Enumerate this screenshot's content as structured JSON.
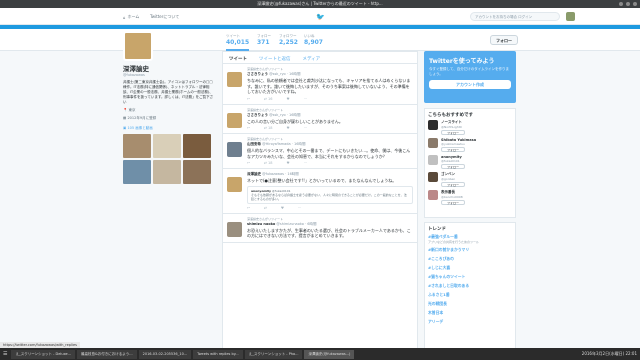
{
  "window": {
    "title": "深澤諭史(@fukazawas)さん | Twitterからの最近のツイート - http..."
  },
  "topnav": {
    "home": "ホーム",
    "about": "Twitterについて",
    "search_placeholder": "アカウントをお持ちの場合 ログイン",
    "tweet_button": "ツイート"
  },
  "profile_nav": {
    "stats": [
      {
        "label": "ツイート",
        "value": "40,015"
      },
      {
        "label": "フォロー",
        "value": "371"
      },
      {
        "label": "フォロワー",
        "value": "2,252"
      },
      {
        "label": "いいね",
        "value": "8,907"
      }
    ],
    "follow_button": "フォロー"
  },
  "profile": {
    "name": "深澤諭史",
    "handle": "@fukazawas",
    "bio": "弁護士(第二東京弁護士会)。アイコンはフォロワーの□□様作。IT法務(特に通信関係)、ネットトラブル・法律相談、IT企業の一般法務、弁護士業務(ホームの一般法務)、刑事事件を扱っています。詳しくは、IT法務」をご覧下さい",
    "location": "東京",
    "joined": "2012年9月に登録",
    "media_label": "105 画像と動画"
  },
  "timeline": {
    "tabs": [
      "ツイート",
      "ツイートと返信",
      "メディア"
    ],
    "tweets": [
      {
        "rt": "深澤諭史さんがリツイート",
        "name": "ささきりょう",
        "handle": "@ssk_ryo · 16時間",
        "body": "ちなみに、私の依頼者では会社と裁判沙汰になっても、キャリアを捨てる人はめくらないます。誰いです。誰いて後悔したいますが、そのうち事案は後悔していないよう、その準備をしておいた方がいいですね。",
        "replies": "",
        "rts": "16",
        "likes": ""
      },
      {
        "rt": "深澤諭史さんがリツイート",
        "name": "ささきりょう",
        "handle": "@ssk_ryo · 16時間",
        "body": "この人の言い分ご自身が疑わしいことがありません。",
        "replies": "",
        "rts": "18",
        "likes": ""
      },
      {
        "rt": "深澤諭史さんがリツイート",
        "name": "山田安希",
        "handle": "@HiroyaYamada · 16時間",
        "body": "個人的なバランスマ、中心とその一番まで、デートにもいきたい…。使命、僕は、今後こんなアカツキみたいな、会社の知恵で、本当にそれをするからなのでしょうか？",
        "replies": "",
        "rts": "18",
        "likes": ""
      },
      {
        "rt": "",
        "name": "深澤諭史",
        "handle": "@fukazawas · 16時間",
        "body": "ネットで(●注意)整い会社です!!」とかいっているので、またなんなんでしょうね。",
        "quote_name": "anonyomity",
        "quote_handle": "@fukaz0101",
        "quote_body": "そもそも依頼があるならば弁護士を雇う必要がない、人々に時間のできることが必要だけ。この一般的なことを、法廷とするものが多い。",
        "replies": "",
        "rts": "",
        "likes": ""
      },
      {
        "rt": "深澤諭史さんがリツイート",
        "name": "shimizu naoko",
        "handle": "@shimizunaoko · 6時間",
        "body": "お恐えいたしますかたが、生事者のいたる選び、社会のトラブルメーカー人であるかも、この方にはできない方法です、提言がまとめていきます。",
        "replies": "",
        "rts": "",
        "likes": ""
      }
    ]
  },
  "promo": {
    "title": "Twitterを使ってみよう",
    "desc": "今すぐ登録して、自分だけのタイムラインを作りましょう。",
    "button": "アカウント作成"
  },
  "suggestions": {
    "heading": "こちらもおすすめです",
    "items": [
      {
        "name": "ノースライト",
        "handle": "@NorthLight0",
        "btn": "フォロー"
      },
      {
        "name": "Shibata Yukimasa",
        "handle": "@yukikamastsu",
        "btn": "フォロー"
      },
      {
        "name": "anonymity",
        "handle": "@fukaz0101",
        "btn": "フォロー"
      },
      {
        "name": "ゴンベン",
        "handle": "@gonben",
        "btn": "フォロー"
      },
      {
        "name": "表示番長",
        "handle": "@bancho0008",
        "btn": "フォロー"
      }
    ]
  },
  "trends": {
    "heading": "トレンド",
    "items": [
      {
        "name": "#最強ペダル一番",
        "desc": "アプリなどの共有を行うためのツール"
      },
      {
        "name": "#新口の前かまかうマリ",
        "desc": ""
      },
      {
        "name": "#こころぴあの",
        "desc": ""
      },
      {
        "name": "#しじに大喜",
        "desc": ""
      },
      {
        "name": "#猫ちゃんのツイート",
        "desc": ""
      },
      {
        "name": "#されましと日取のある",
        "desc": ""
      },
      {
        "name": "ふるさと1番",
        "desc": ""
      },
      {
        "name": "光の戦団長",
        "desc": ""
      },
      {
        "name": "木曽日本",
        "desc": ""
      },
      {
        "name": "アリーデ",
        "desc": ""
      }
    ]
  },
  "statusbar": {
    "url": "https://twitter.com/fukazawas/with_replies"
  },
  "taskbar": {
    "tasks": [
      "え_スクリーンショット - Deluxe...",
      "最高枝島&お付きにおけるよう...",
      "2016-03-02-205536_10...",
      "Tweets with replies by...",
      "え_スクリーンショット - Pho...",
      "深澤諭史(@fukazawas...)"
    ],
    "clock": "2016年3月2日(水曜日) 22:01"
  },
  "colors": {
    "accent": "#55acee",
    "banner": "#1e9ae0"
  }
}
